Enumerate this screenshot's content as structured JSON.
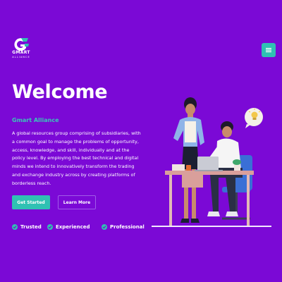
{
  "header": {
    "logo": {
      "name": "GMART",
      "sub": "ALLIANCE",
      "icon": "g-logo-icon"
    },
    "menu": {
      "icon": "hamburger-menu-icon"
    }
  },
  "hero": {
    "title": "Welcome",
    "company": "Gmart Alliance",
    "description": "A global resources group comprising of subsidiaries, with a common goal to manage the problems of opportunity, access, knowledge, and skill, individually and at the policy level. By employing the best technical and digital minds we intend to innovatively transform the trading and exchange industry across by creating platforms of borderless reach.",
    "buttons": {
      "primary": "Get Started",
      "secondary": "Learn More"
    },
    "features": [
      "Trusted",
      "Experienced",
      "Professional"
    ],
    "illustration": "office-team-illustration"
  },
  "colors": {
    "background": "#7b09d6",
    "accent": "#2fc1b3",
    "company_text": "#38c7b9",
    "button_border": "#a05ce8"
  }
}
